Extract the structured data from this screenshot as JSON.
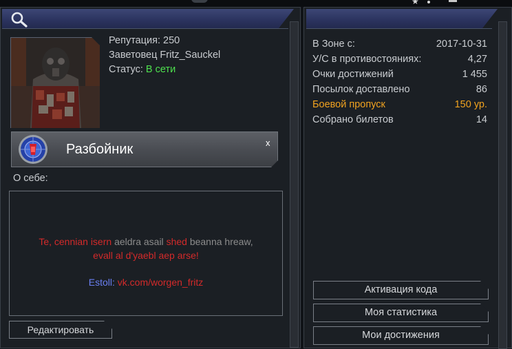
{
  "profile": {
    "reputation": "Репутация: 250",
    "player": "Заветовец Fritz_Sauckel",
    "status_label": "Статус: ",
    "status_value": "В сети",
    "status_color": "#4ee04e"
  },
  "class_banner": {
    "name": "Разбойник",
    "close_label": "x"
  },
  "about": {
    "label": "О себе:",
    "line1": [
      {
        "text": "Te, cennian isern ",
        "color": "red"
      },
      {
        "text": "aeldra asail ",
        "color": "grey"
      },
      {
        "text": "shed ",
        "color": "red"
      },
      {
        "text": "beanna hreaw,",
        "color": "grey"
      }
    ],
    "line2": "evall al d'yaebl aep arse!",
    "line3_prefix": "Estoll: ",
    "line3_link": "vk.com/worgen_fritz"
  },
  "edit_button": "Редактировать",
  "stats": [
    {
      "label": "В Зоне с:",
      "value": "2017-10-31",
      "highlight": false
    },
    {
      "label": "У/С в противостояниях:",
      "value": "4,27",
      "highlight": false
    },
    {
      "label": "Очки достижений",
      "value": "1 455",
      "highlight": false
    },
    {
      "label": "Посылок доставлено",
      "value": "86",
      "highlight": false
    },
    {
      "label": "Боевой пропуск",
      "value": "150 ур.",
      "highlight": true
    },
    {
      "label": "Собрано билетов",
      "value": "14",
      "highlight": false
    }
  ],
  "actions": {
    "activate_code": "Активация кода",
    "my_statistics": "Моя статистика",
    "my_achievements": "Мои достижения"
  },
  "colors": {
    "accent_orange": "#f0a21f",
    "text_red": "#d32a2a",
    "text_blue": "#6a7ff2",
    "header_band": "#2c3460"
  }
}
